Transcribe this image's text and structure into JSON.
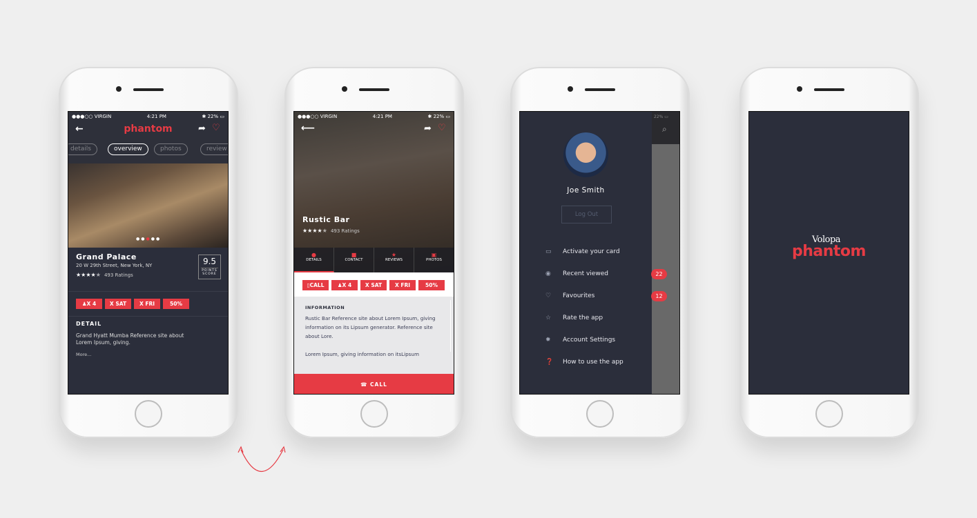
{
  "status": {
    "carrier": "●●●○○ VIRGIN",
    "time": "4:21 PM",
    "battery": "22%"
  },
  "screen1": {
    "logo": "phantom",
    "tabs": [
      "details",
      "overview",
      "photos",
      "review"
    ],
    "active_tab": "overview",
    "name": "Grand Palace",
    "address": "20 W 29th Street, New York, NY",
    "rating": 4.5,
    "ratings_text": "493 Ratings",
    "score": "9.5",
    "score_label_1": "POINTS",
    "score_label_2": "SCORE",
    "tags": [
      "X 4",
      "X SAT",
      "X FRI",
      "50%"
    ],
    "detail_title": "DETAIL",
    "detail_text": "Grand Hyatt Mumba Reference site about Lorem Ipsum, giving.",
    "more": "More..."
  },
  "screen2": {
    "name": "Rustic Bar",
    "rating": 4.5,
    "ratings_text": "493 Ratings",
    "tabs": [
      "DETAILS",
      "CONTACT",
      "REVIEWS",
      "PHOTOS"
    ],
    "active_tab": "DETAILS",
    "tags": [
      "CALL",
      "X 4",
      "X SAT",
      "X FRI",
      "50%"
    ],
    "info_title": "INFORMATION",
    "info_text": "Rustic Bar Reference site about Lorem Ipsum, giving information on its Lipsum generator. Reference site about Lore.",
    "info_text2": "Lorem Ipsum, giving information on itsLipsum",
    "call": "CALL"
  },
  "screen3": {
    "user": "Joe Smith",
    "logout": "Log Out",
    "items": [
      {
        "label": "Activate your card",
        "icon": "card-icon"
      },
      {
        "label": "Recent viewed",
        "icon": "eye-icon",
        "badge": "22"
      },
      {
        "label": "Favourites",
        "icon": "heart-icon",
        "badge": "12"
      },
      {
        "label": "Rate the app",
        "icon": "star-icon"
      },
      {
        "label": "Account Settings",
        "icon": "gear-icon"
      },
      {
        "label": "How to use the app",
        "icon": "help-icon"
      }
    ]
  },
  "screen4": {
    "brand_top": "Volopa",
    "brand": "phantom"
  },
  "colors": {
    "accent": "#e63b44",
    "dark": "#2b2e3b"
  }
}
